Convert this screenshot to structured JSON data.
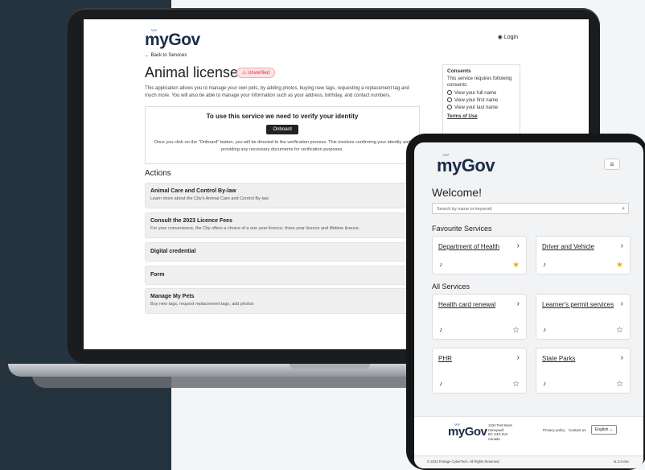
{
  "laptop": {
    "logo_my": "my",
    "logo_gov": "Gov",
    "login": "Login",
    "back": "← Back to Services",
    "title": "Animal licenses",
    "badge": "Unverified",
    "description": "This application allows you to manage your own pets, by adding photos, buying new tags, requesting a replacement tag and much more. You will also be able to manage your information such as your address, birthday, and contact numbers.",
    "verify": {
      "title": "To use this service we need to verify your identity",
      "button": "Onboard",
      "desc": "Once you click on the \"Onboard\" button, you will be directed to the verification process. This involves confirming your identity and providing any necessary documents for verification purposes."
    },
    "actions_heading": "Actions",
    "actions": [
      {
        "title": "Animal Care and Control By-law",
        "desc": "Learn more about the City's Animal Care and Control By-law",
        "link": "L"
      },
      {
        "title": "Consult the 2023 Licence Fees",
        "desc": "For your convenience, the City offers a choice of a one year licence, three year licence and lifetime licence.",
        "link": "L"
      },
      {
        "title": "Digital credential",
        "desc": "",
        "link": "L"
      },
      {
        "title": "Form",
        "desc": "",
        "link": "L"
      },
      {
        "title": "Manage My Pets",
        "desc": "Buy new tags, request replacement tags, add photos",
        "link": "L"
      }
    ],
    "consents": {
      "heading": "Consents",
      "subtitle": "This service requires following consents:",
      "items": [
        "View your full name",
        "View your first name",
        "View your last name"
      ],
      "terms": "Terms of Use"
    }
  },
  "tablet": {
    "logo_my": "my",
    "logo_gov": "Gov",
    "menu_icon": "≡",
    "welcome": "Welcome!",
    "search_placeholder": "Search by name or keyword",
    "favourites_heading": "Favourite Services",
    "favourites": [
      {
        "title": "Department of Health",
        "starred": true
      },
      {
        "title": "Driver and Vehicle",
        "starred": true
      }
    ],
    "all_heading": "All Services",
    "services": [
      {
        "title": "Health card renewal",
        "starred": false
      },
      {
        "title": "Learner's permit services",
        "starred": false
      },
      {
        "title": "PHR",
        "starred": false
      },
      {
        "title": "State Parks",
        "starred": false
      }
    ],
    "footer": {
      "address": [
        "1234 Test street",
        "Honeywell",
        "BC H4G 5V3",
        "Canada"
      ],
      "privacy": "Privacy policy",
      "contact": "Contact us",
      "language": "English ⌄",
      "copyright": "© 2023 Portage CyberTech. All Rights Reserved.",
      "version": "v1.3.0-dev"
    }
  },
  "colors": {
    "dark_bg": "#24333d",
    "star_on": "#f0a818",
    "badge_red": "#c33"
  }
}
